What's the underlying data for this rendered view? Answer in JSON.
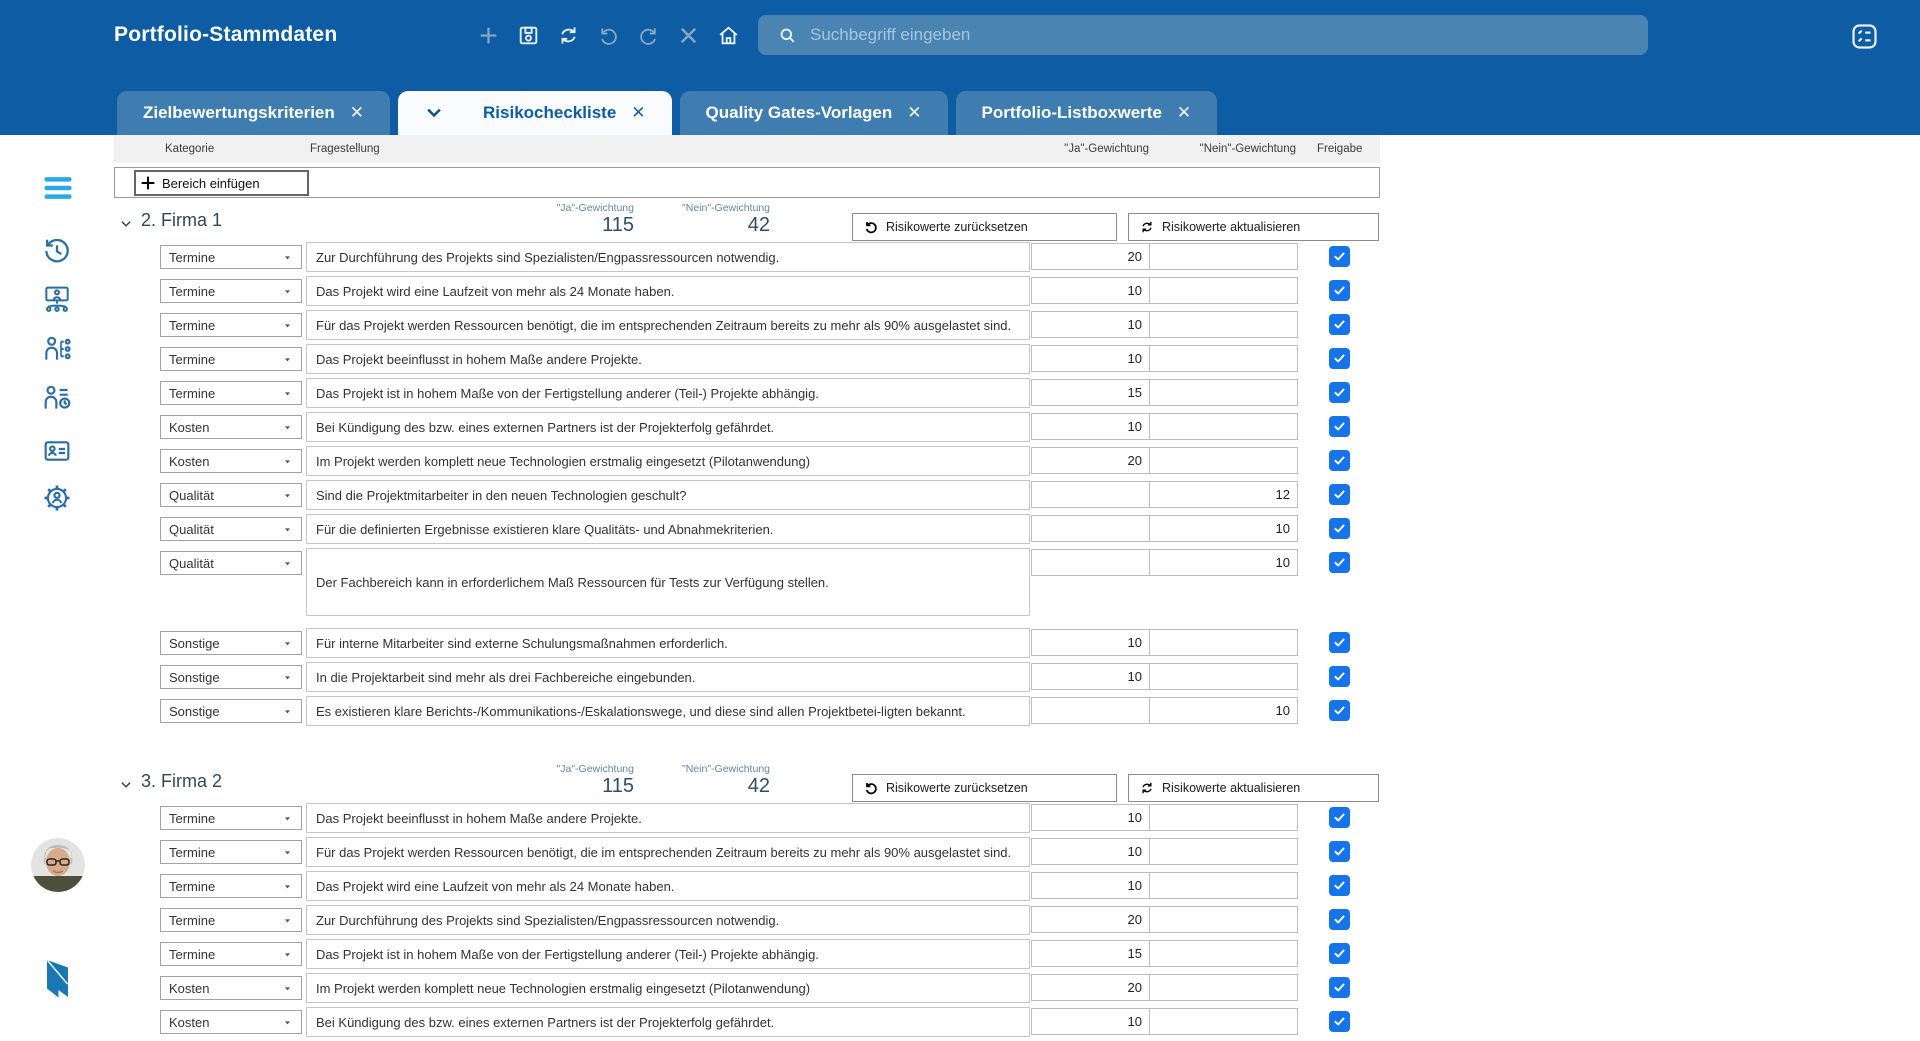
{
  "header": {
    "title": "Portfolio-Stammdaten",
    "toolbar_icons": [
      "add",
      "save",
      "refresh",
      "undo",
      "redo",
      "close",
      "home"
    ],
    "search": {
      "placeholder": "Suchbegriff eingeben"
    },
    "right_icon": "task-list",
    "colors": {
      "header_bg": "#0d5ca4",
      "tab_inactive": "#3f7db1",
      "tab_active": "#fafbfc",
      "checkbox": "#1574e8"
    }
  },
  "tabs": [
    {
      "label": "Zielbewertungskriterien",
      "active": false
    },
    {
      "label": "Risikocheckliste",
      "active": true
    },
    {
      "label": "Quality Gates-Vorlagen",
      "active": false
    },
    {
      "label": "Portfolio-Listboxwerte",
      "active": false
    }
  ],
  "sidebar": {
    "icons": [
      "menu",
      "history",
      "org-chart",
      "person-hierarchy",
      "person-time",
      "id-card",
      "settings-user"
    ]
  },
  "table": {
    "columns": {
      "kategorie": "Kategorie",
      "fragestellung": "Fragestellung",
      "ja": "\"Ja\"-Gewichtung",
      "nein": "\"Nein\"-Gewichtung",
      "freigabe": "Freigabe"
    },
    "insert_button": "Bereich einfügen",
    "ja_label": "\"Ja\"-Gewichtung",
    "nein_label": "\"Nein\"-Gewichtung",
    "buttons": {
      "reset": "Risikowerte zurücksetzen",
      "update": "Risikowerte aktualisieren"
    },
    "sections": [
      {
        "title": "2. Firma 1",
        "ja_total": "115",
        "nein_total": "42",
        "rows": [
          {
            "kategorie": "Termine",
            "frage": "Zur Durchführung des Projekts sind Spezialisten/Engpassressourcen notwendig.",
            "ja": "20",
            "nein": "",
            "checked": true
          },
          {
            "kategorie": "Termine",
            "frage": "Das Projekt wird eine Laufzeit von mehr als 24 Monate haben.",
            "ja": "10",
            "nein": "",
            "checked": true
          },
          {
            "kategorie": "Termine",
            "frage": "Für das Projekt werden Ressourcen benötigt, die im entsprechenden Zeitraum bereits zu mehr als 90% ausgelastet sind.",
            "ja": "10",
            "nein": "",
            "checked": true
          },
          {
            "kategorie": "Termine",
            "frage": "Das Projekt beeinflusst in hohem Maße andere Projekte.",
            "ja": "10",
            "nein": "",
            "checked": true
          },
          {
            "kategorie": "Termine",
            "frage": "Das Projekt ist in hohem Maße von der Fertigstellung anderer (Teil-) Projekte abhängig.",
            "ja": "15",
            "nein": "",
            "checked": true
          },
          {
            "kategorie": "Kosten",
            "frage": "Bei Kündigung des bzw. eines externen Partners ist der Projekterfolg gefährdet.",
            "ja": "10",
            "nein": "",
            "checked": true
          },
          {
            "kategorie": "Kosten",
            "frage": "Im Projekt werden komplett neue Technologien erstmalig eingesetzt (Pilotanwendung)",
            "ja": "20",
            "nein": "",
            "checked": true
          },
          {
            "kategorie": "Qualität",
            "frage": "Sind die Projektmitarbeiter in den neuen Technologien geschult?",
            "ja": "",
            "nein": "12",
            "checked": true
          },
          {
            "kategorie": "Qualität",
            "frage": "Für die definierten Ergebnisse existieren klare Qualitäts- und Abnahmekriterien.",
            "ja": "",
            "nein": "10",
            "checked": true
          },
          {
            "kategorie": "Qualität",
            "frage": "Der Fachbereich kann in erforderlichem Maß Ressourcen für Tests zur Verfügung stellen.",
            "ja": "",
            "nein": "10",
            "checked": true,
            "tall": true
          },
          {
            "kategorie": "Sonstige",
            "frage": "Für interne Mitarbeiter sind externe Schulungsmaßnahmen erforderlich.",
            "ja": "10",
            "nein": "",
            "checked": true
          },
          {
            "kategorie": "Sonstige",
            "frage": "In die Projektarbeit sind mehr als drei Fachbereiche eingebunden.",
            "ja": "10",
            "nein": "",
            "checked": true
          },
          {
            "kategorie": "Sonstige",
            "frage": "Es existieren klare Berichts-/Kommunikations-/Eskalationswege, und diese sind allen Projektbetei-ligten bekannt.",
            "ja": "",
            "nein": "10",
            "checked": true
          }
        ]
      },
      {
        "title": "3. Firma 2",
        "ja_total": "115",
        "nein_total": "42",
        "rows": [
          {
            "kategorie": "Termine",
            "frage": "Das Projekt beeinflusst in hohem Maße andere Projekte.",
            "ja": "10",
            "nein": "",
            "checked": true
          },
          {
            "kategorie": "Termine",
            "frage": "Für das Projekt werden Ressourcen benötigt, die im entsprechenden Zeitraum bereits zu mehr als 90% ausgelastet sind.",
            "ja": "10",
            "nein": "",
            "checked": true
          },
          {
            "kategorie": "Termine",
            "frage": "Das Projekt wird eine Laufzeit von mehr als 24 Monate haben.",
            "ja": "10",
            "nein": "",
            "checked": true
          },
          {
            "kategorie": "Termine",
            "frage": "Zur Durchführung des Projekts sind Spezialisten/Engpassressourcen notwendig.",
            "ja": "20",
            "nein": "",
            "checked": true
          },
          {
            "kategorie": "Termine",
            "frage": "Das Projekt ist in hohem Maße von der Fertigstellung anderer (Teil-) Projekte abhängig.",
            "ja": "15",
            "nein": "",
            "checked": true
          },
          {
            "kategorie": "Kosten",
            "frage": "Im Projekt werden komplett neue Technologien erstmalig eingesetzt (Pilotanwendung)",
            "ja": "20",
            "nein": "",
            "checked": true
          },
          {
            "kategorie": "Kosten",
            "frage": "Bei Kündigung des bzw. eines externen Partners ist der Projekterfolg gefährdet.",
            "ja": "10",
            "nein": "",
            "checked": true
          }
        ]
      }
    ]
  }
}
